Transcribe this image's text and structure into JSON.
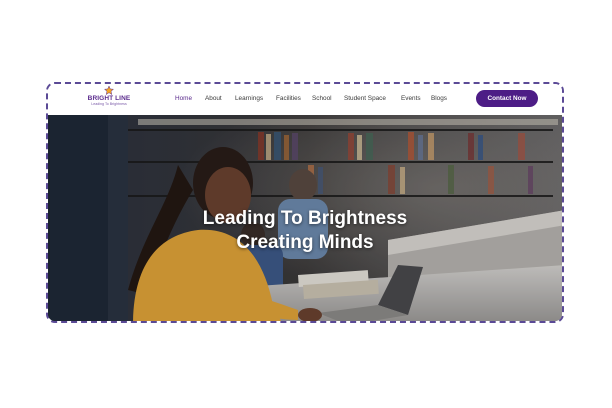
{
  "brand": {
    "name": "BRIGHT LINE",
    "tagline": "Leading To Brightness",
    "logo_icon": "star-icon",
    "colors": {
      "primary": "#4d1d86",
      "accent": "#f5a623",
      "frame_border": "#5b4a96"
    }
  },
  "nav": {
    "items": [
      {
        "label": "Home",
        "active": true
      },
      {
        "label": "About",
        "active": false
      },
      {
        "label": "Learnings",
        "active": false
      },
      {
        "label": "Facilities",
        "active": false
      },
      {
        "label": "School",
        "active": false
      },
      {
        "label": "Student Space",
        "active": false
      },
      {
        "label": "Events",
        "active": false
      },
      {
        "label": "Blogs",
        "active": false
      }
    ],
    "cta_label": "Contact Now"
  },
  "hero": {
    "headline_line1": "Leading To Brightness",
    "headline_line2": "Creating Minds",
    "image": "student studying in library"
  }
}
